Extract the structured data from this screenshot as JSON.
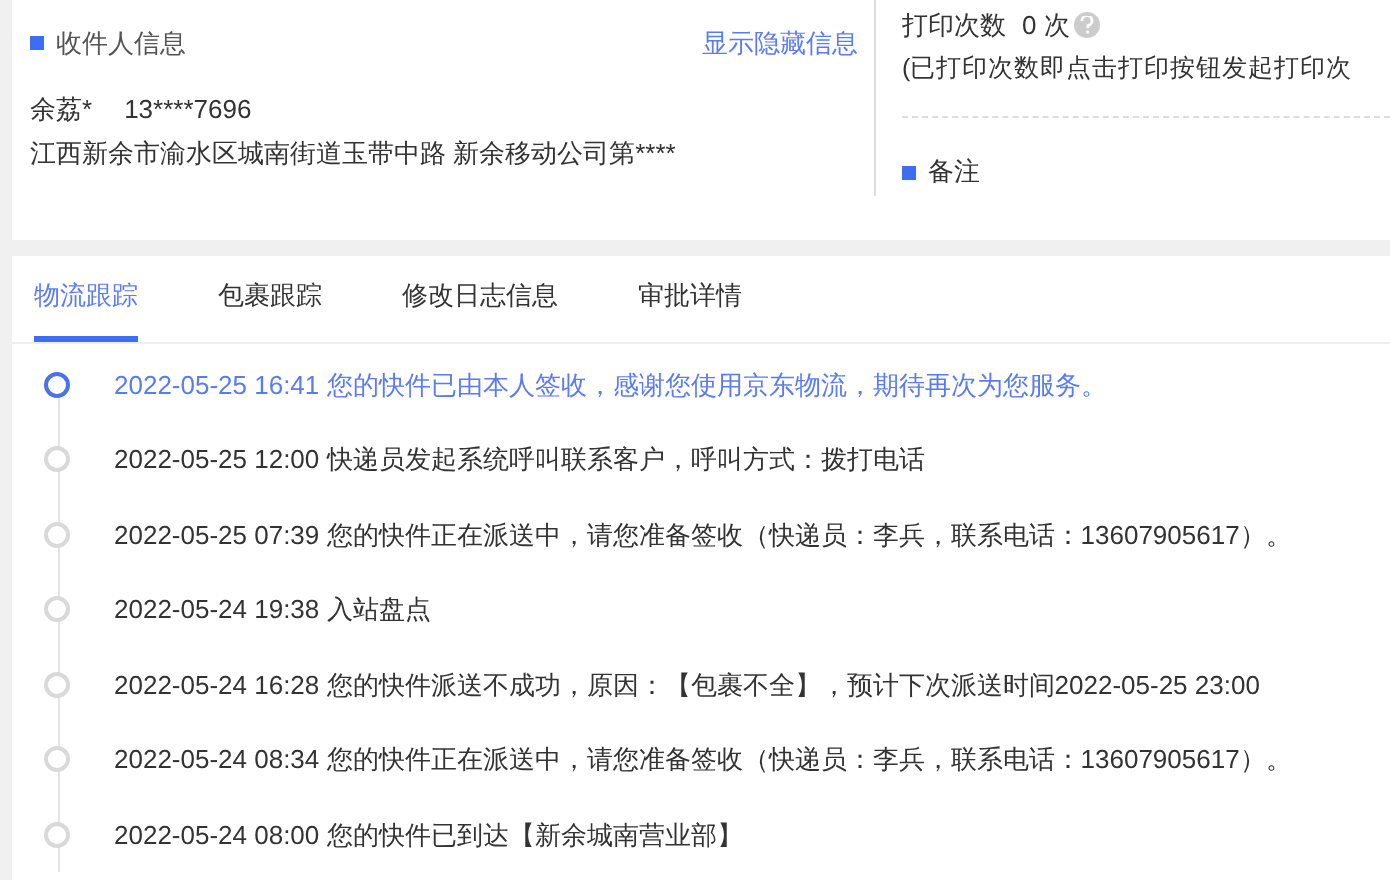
{
  "recipient": {
    "title": "收件人信息",
    "toggle_link": "显示隐藏信息",
    "name": "余荔*",
    "phone": "13****7696",
    "address": "江西新余市渝水区城南街道玉带中路 新余移动公司第****"
  },
  "print": {
    "label": "打印次数",
    "count": "0 次",
    "note": "(已打印次数即点击打印按钮发起打印次"
  },
  "remarks": {
    "title": "备注"
  },
  "tabs": [
    {
      "label": "物流跟踪",
      "selected": true
    },
    {
      "label": "包裹跟踪",
      "selected": false
    },
    {
      "label": "修改日志信息",
      "selected": false
    },
    {
      "label": "审批详情",
      "selected": false
    }
  ],
  "timeline": [
    {
      "time": "2022-05-25 16:41",
      "text": "您的快件已由本人签收，感谢您使用京东物流，期待再次为您服务。",
      "selected": true
    },
    {
      "time": "2022-05-25 12:00",
      "text": "快递员发起系统呼叫联系客户，呼叫方式：拨打电话",
      "selected": false
    },
    {
      "time": "2022-05-25 07:39",
      "text": "您的快件正在派送中，请您准备签收（快递员：李兵，联系电话：13607905617）。",
      "selected": false
    },
    {
      "time": "2022-05-24 19:38",
      "text": "入站盘点",
      "selected": false
    },
    {
      "time": "2022-05-24 16:28",
      "text": "您的快件派送不成功，原因：【包裹不全】，预计下次派送时间2022-05-25 23:00",
      "selected": false
    },
    {
      "time": "2022-05-24 08:34",
      "text": "您的快件正在派送中，请您准备签收（快递员：李兵，联系电话：13607905617）。",
      "selected": false
    },
    {
      "time": "2022-05-24 08:00",
      "text": "您的快件已到达【新余城南营业部】",
      "selected": false
    }
  ]
}
